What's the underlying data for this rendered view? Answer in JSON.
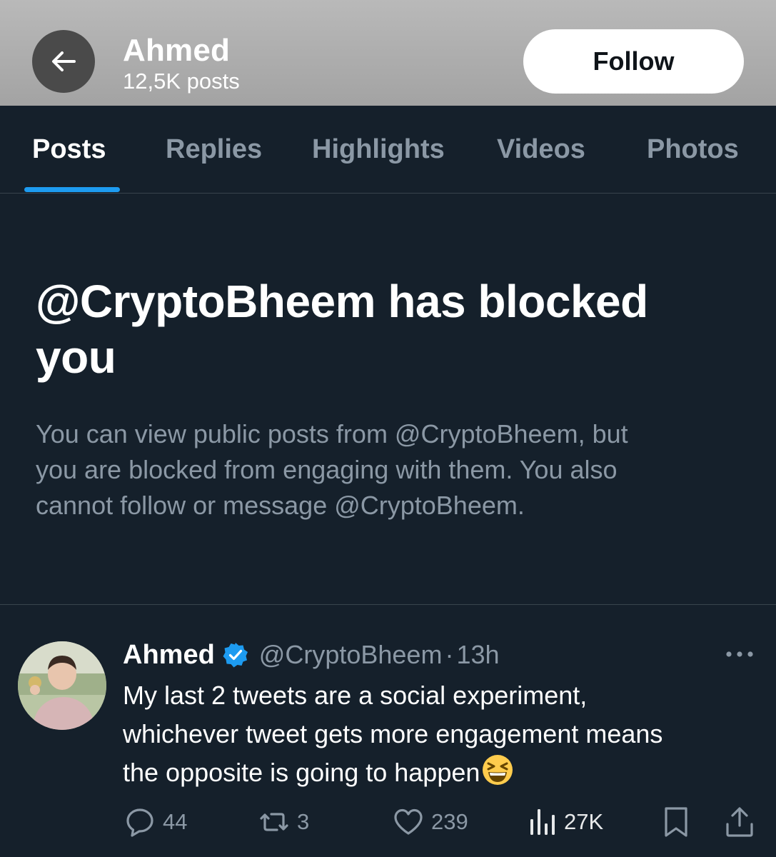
{
  "header": {
    "name": "Ahmed",
    "posts_count": "12,5K posts",
    "follow_label": "Follow"
  },
  "tabs": [
    {
      "label": "Posts",
      "active": true
    },
    {
      "label": "Replies",
      "active": false
    },
    {
      "label": "Highlights",
      "active": false
    },
    {
      "label": "Videos",
      "active": false
    },
    {
      "label": "Photos",
      "active": false
    }
  ],
  "blocked": {
    "title_line1": "@CryptoBheem has blocked",
    "title_line2": "you",
    "description_line1": "You can view public posts from @CryptoBheem, but",
    "description_line2": "you are blocked from engaging with them. You also",
    "description_line3": "cannot follow or message @CryptoBheem."
  },
  "tweet": {
    "author_name": "Ahmed",
    "handle": "@CryptoBheem",
    "separator": "·",
    "time": "13h",
    "text_line1": "My last 2 tweets are a social experiment,",
    "text_line2": "whichever tweet gets more engagement means",
    "text_line3": "the opposite is going to happen",
    "emoji": "grinning-squinting-face",
    "replies": "44",
    "reposts": "3",
    "likes": "239",
    "views": "27K"
  },
  "colors": {
    "background": "#15202b",
    "header_bg": "#b0b0b0",
    "accent": "#1d9bf0",
    "muted_text": "#8b98a5",
    "divider": "#38444d"
  },
  "icons": [
    "back-arrow-icon",
    "verified-badge-icon",
    "more-icon",
    "reply-icon",
    "repost-icon",
    "like-icon",
    "views-icon",
    "bookmark-icon",
    "share-icon"
  ]
}
